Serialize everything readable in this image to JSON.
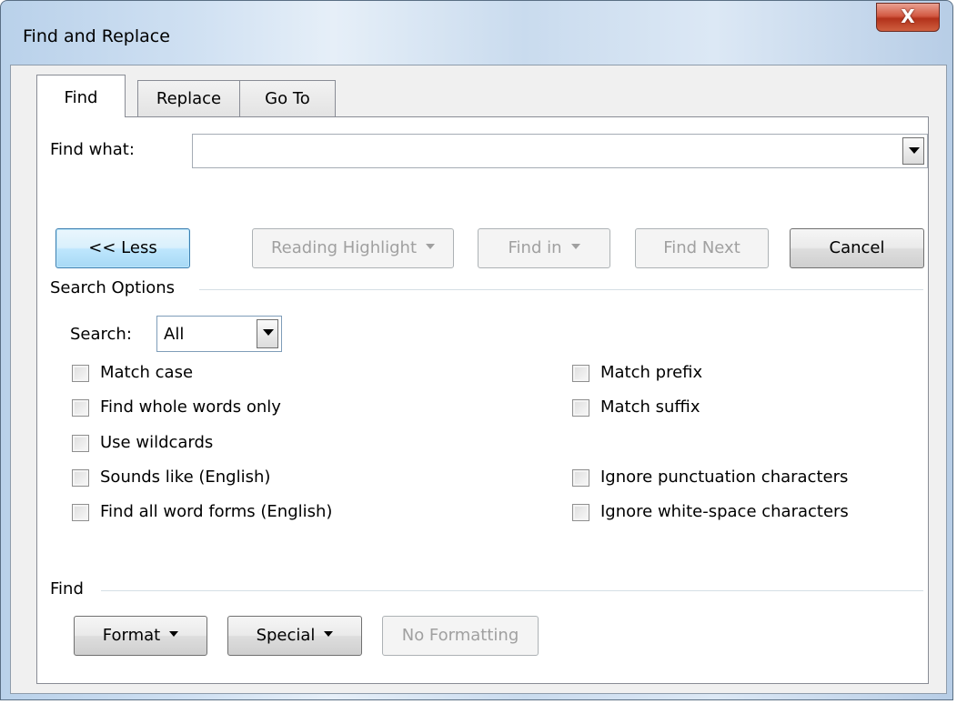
{
  "window": {
    "title": "Find and Replace",
    "close_glyph": "X"
  },
  "tabs": [
    {
      "label": "Find",
      "active": true
    },
    {
      "label": "Replace",
      "active": false
    },
    {
      "label": "Go To",
      "active": false
    }
  ],
  "find_what": {
    "label": "Find what:",
    "value": ""
  },
  "buttons": {
    "less": "<< Less",
    "reading_highlight": "Reading Highlight",
    "find_in": "Find in",
    "find_next": "Find Next",
    "cancel": "Cancel"
  },
  "search_options": {
    "heading": "Search Options",
    "search_label": "Search:",
    "search_value": "All",
    "left_options": [
      {
        "label": "Match case",
        "checked": false
      },
      {
        "label": "Find whole words only",
        "checked": false
      },
      {
        "label": "Use wildcards",
        "checked": false
      },
      {
        "label": "Sounds like (English)",
        "checked": false
      },
      {
        "label": "Find all word forms (English)",
        "checked": false
      }
    ],
    "right_options": [
      {
        "label": "Match prefix",
        "checked": false
      },
      {
        "label": "Match suffix",
        "checked": false
      },
      {
        "label": "Ignore punctuation characters",
        "checked": false
      },
      {
        "label": "Ignore white-space characters",
        "checked": false
      }
    ]
  },
  "find_section": {
    "heading": "Find",
    "format": "Format",
    "special": "Special",
    "no_formatting": "No Formatting"
  },
  "colors": {
    "default_button_border": "#3c7fb1",
    "close_button": "#c7452c",
    "disabled_text": "#a0a0a0"
  }
}
